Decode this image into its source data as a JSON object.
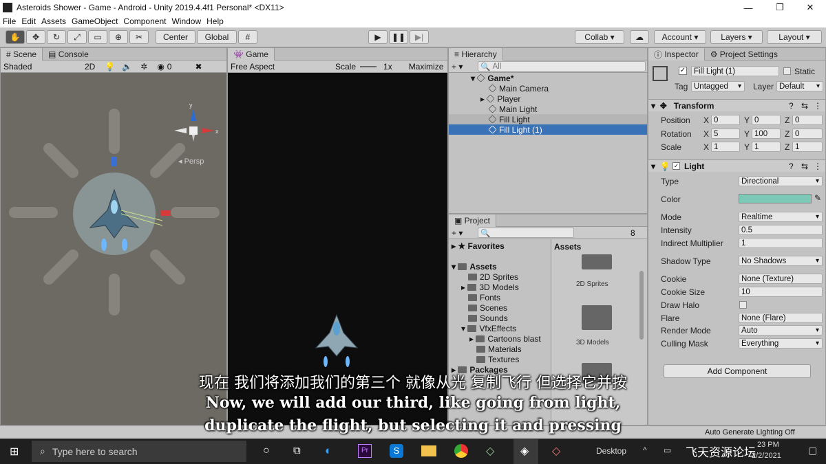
{
  "window": {
    "title": "Asteroids Shower - Game - Android - Unity 2019.4.4f1 Personal* <DX11>"
  },
  "menu": [
    "File",
    "Edit",
    "Assets",
    "GameObject",
    "Component",
    "Window",
    "Help"
  ],
  "toolbar": {
    "center": "Center",
    "global": "Global",
    "collab": "Collab",
    "account": "Account",
    "layers": "Layers",
    "layout": "Layout"
  },
  "scene": {
    "tab": "Scene",
    "console_tab": "Console",
    "shading": "Shaded",
    "mode2d": "2D",
    "gizmo_count": "0",
    "persp": "Persp"
  },
  "game": {
    "tab": "Game",
    "aspect": "Free Aspect",
    "scale_label": "Scale",
    "scale_value": "1x",
    "maximize": "Maximize"
  },
  "hierarchy": {
    "tab": "Hierarchy",
    "search": "All",
    "items": [
      {
        "label": "Game*"
      },
      {
        "label": "Main Camera"
      },
      {
        "label": "Player"
      },
      {
        "label": "Main Light"
      },
      {
        "label": "Fill Light"
      },
      {
        "label": "Fill Light (1)"
      }
    ]
  },
  "project": {
    "tab": "Project",
    "count": "8",
    "favorites": "Favorites",
    "assets": "Assets",
    "assets_header": "Assets",
    "tree": [
      "2D Sprites",
      "3D Models",
      "Fonts",
      "Scenes",
      "Sounds",
      "VfxEffects",
      "Cartoons blast",
      "Materials",
      "Textures"
    ],
    "packages": "Packages",
    "grid": [
      "2D Sprites",
      "3D Models"
    ]
  },
  "inspector": {
    "tab": "Inspector",
    "settings_tab": "Project Settings",
    "name": "Fill Light (1)",
    "static": "Static",
    "tag_label": "Tag",
    "tag": "Untagged",
    "layer_label": "Layer",
    "layer": "Default",
    "transform": {
      "title": "Transform",
      "position": "Position",
      "rotation": "Rotation",
      "scale": "Scale",
      "pos": [
        "0",
        "0",
        "0"
      ],
      "rot": [
        "5",
        "100",
        "0"
      ],
      "scl": [
        "1",
        "1",
        "1"
      ]
    },
    "light": {
      "title": "Light",
      "rows": [
        {
          "label": "Type",
          "value": "Directional"
        },
        {
          "label": "Color",
          "value": ""
        },
        {
          "label": "Mode",
          "value": "Realtime"
        },
        {
          "label": "Intensity",
          "value": "0.5"
        },
        {
          "label": "Indirect Multiplier",
          "value": "1"
        },
        {
          "label": "Shadow Type",
          "value": "No Shadows"
        },
        {
          "label": "Cookie",
          "value": "None (Texture)"
        },
        {
          "label": "Cookie Size",
          "value": "10"
        },
        {
          "label": "Draw Halo",
          "value": ""
        },
        {
          "label": "Flare",
          "value": "None (Flare)"
        },
        {
          "label": "Render Mode",
          "value": "Auto"
        },
        {
          "label": "Culling Mask",
          "value": "Everything"
        }
      ],
      "color": "#7ec8b8"
    },
    "add_component": "Add Component",
    "status": "Auto Generate Lighting Off"
  },
  "subtitles": {
    "cn": "现在 我们将添加我们的第三个 就像从光 复制飞行 但选择它并按",
    "en1": "Now, we will add our third, like going from light,",
    "en2": "duplicate the flight, but selecting it and pressing"
  },
  "taskbar": {
    "search": "Type here to search",
    "desktop": "Desktop",
    "time": "23 PM",
    "date": "2/2/2021",
    "watermark": "飞天资源论坛"
  }
}
